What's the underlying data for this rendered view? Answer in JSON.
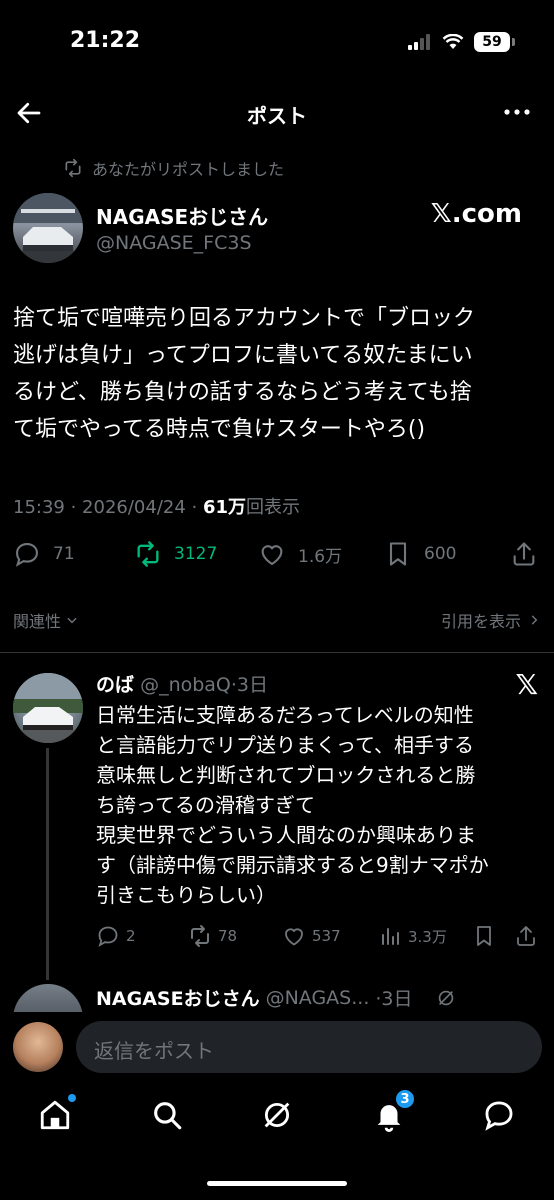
{
  "status_bar": {
    "time": "21:22",
    "battery": "59"
  },
  "header": {
    "title": "ポスト"
  },
  "post": {
    "repost_note": "あなたがリポストしました",
    "author_name": "NAGASEおじさん",
    "author_handle": "@NAGASE_FC3S",
    "source_badge": "𝕏.com",
    "text_lines": [
      "捨て垢で喧嘩売り回るアカウントで「ブロック",
      "逃げは負け」ってプロフに書いてる奴たまにい",
      "るけど、勝ち負けの話するならどう考えても捨",
      "て垢でやってる時点で負けスタートやろ()"
    ],
    "timestamp": "15:39 · 2026/04/24 · ",
    "views_count": "61万",
    "views_label": "回表示",
    "replies": "71",
    "reposts": "3127",
    "likes": "1.6万",
    "bookmarks": "600",
    "repost_color": "#00ba7c"
  },
  "sort": {
    "relevance": "関連性",
    "show_quotes": "引用を表示"
  },
  "reply": {
    "name": "のば",
    "handle": "@_nobaQ",
    "age": "·3日",
    "badge": "𝕏",
    "text_lines": [
      "日常生活に支障あるだろってレベルの知性",
      "と言語能力でリプ送りまくって、相手する",
      "意味無しと判断されてブロックされると勝",
      "ち誇ってるの滑稽すぎて",
      "現実世界でどういう人間なのか興味ありま",
      "す（誹謗中傷で開示請求すると9割ナマポか",
      "引きこもりらしい）"
    ],
    "replies": "2",
    "reposts": "78",
    "likes": "537",
    "views": "3.3万"
  },
  "reply2": {
    "name": "NAGASEおじさん",
    "handle": "@NAGAS...",
    "age": "·3日"
  },
  "compose": {
    "placeholder": "返信をポスト"
  },
  "tabbar": {
    "notifications_badge": "3"
  }
}
